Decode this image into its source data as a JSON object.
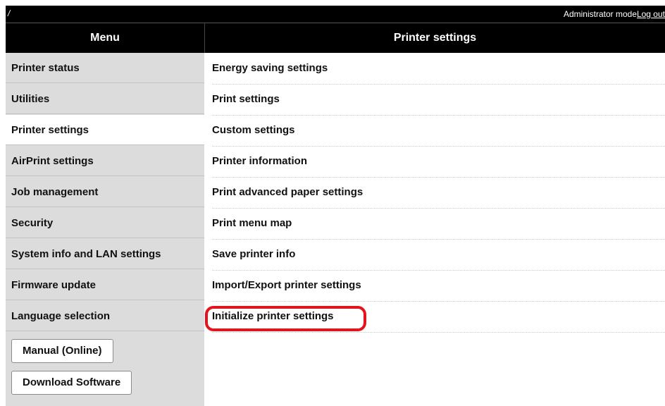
{
  "topbar": {
    "breadcrumb": "/",
    "mode_label": "Administrator mode",
    "logout_label": "Log out"
  },
  "header": {
    "menu_title": "Menu",
    "page_title": "Printer settings"
  },
  "sidebar": {
    "items": [
      {
        "label": "Printer status",
        "active": false
      },
      {
        "label": "Utilities",
        "active": false
      },
      {
        "label": "Printer settings",
        "active": true
      },
      {
        "label": "AirPrint settings",
        "active": false
      },
      {
        "label": "Job management",
        "active": false
      },
      {
        "label": "Security",
        "active": false
      },
      {
        "label": "System info and LAN settings",
        "active": false
      },
      {
        "label": "Firmware update",
        "active": false
      },
      {
        "label": "Language selection",
        "active": false
      }
    ],
    "buttons": [
      {
        "label": "Manual (Online)"
      },
      {
        "label": "Download Software"
      }
    ]
  },
  "content": {
    "items": [
      {
        "label": "Energy saving settings"
      },
      {
        "label": "Print settings"
      },
      {
        "label": "Custom settings"
      },
      {
        "label": "Printer information"
      },
      {
        "label": "Print advanced paper settings"
      },
      {
        "label": "Print menu map"
      },
      {
        "label": "Save printer info"
      },
      {
        "label": "Import/Export printer settings"
      },
      {
        "label": "Initialize printer settings",
        "highlighted": true
      }
    ]
  },
  "colors": {
    "header_bg": "#000000",
    "sidebar_bg": "#dcdcdc",
    "active_item_bg": "#ffffff",
    "highlight_ring": "#e4141c"
  }
}
